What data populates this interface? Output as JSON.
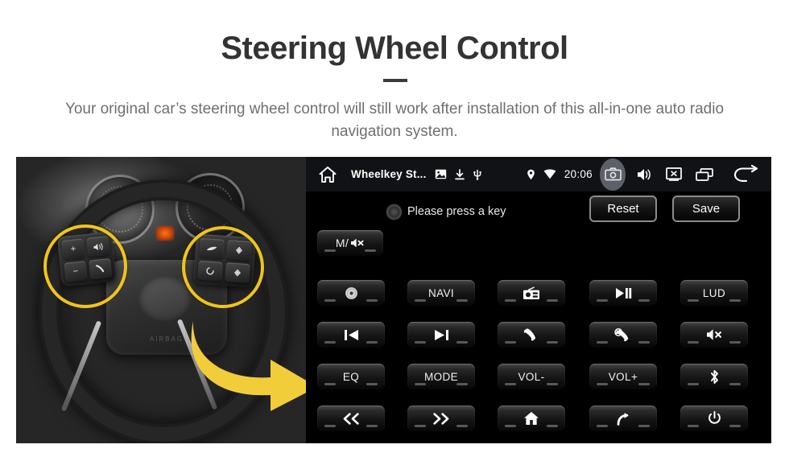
{
  "header": {
    "title": "Steering Wheel Control",
    "subtitle": "Your original car’s steering wheel control will still work after installation of this all-in-one auto radio navigation system."
  },
  "photo": {
    "alt_label": "steering-wheel-photo",
    "airbag_text": "AIRBAG",
    "highlight_color": "#f0c419",
    "arrow_color": "#f2cd3a",
    "left_pad_keys": [
      "+",
      "−",
      "voice-icon",
      "phone-icon"
    ],
    "right_pad_keys": [
      "cruise-icon",
      "up-icon",
      "circle-icon",
      "down-icon"
    ]
  },
  "head_unit": {
    "statusbar": {
      "home_icon": "home-icon",
      "title": "Wheelkey St...",
      "icons": [
        "image-icon",
        "download-icon",
        "usb-icon"
      ],
      "location_icon": "location-pin-icon",
      "wifi_icon": "wifi-icon",
      "clock": "20:06",
      "buttons": [
        {
          "name": "screenshot-icon",
          "active": true
        },
        {
          "name": "volume-icon",
          "active": false
        },
        {
          "name": "close-screen-icon",
          "active": false
        },
        {
          "name": "recent-apps-icon",
          "active": false
        }
      ],
      "back_icon": "back-arrow-icon"
    },
    "prompt": {
      "indicator": "status-indicator",
      "text": "Please press a key"
    },
    "actions": [
      {
        "label": "Reset",
        "name": "reset-button"
      },
      {
        "label": "Save",
        "name": "save-button"
      }
    ],
    "mute_key": {
      "label": "M/",
      "icon": "mute-icon",
      "name": "key-mute-master"
    },
    "keys": [
      [
        {
          "label": "",
          "icon": "disc-icon",
          "name": "key-disc"
        },
        {
          "label": "NAVI",
          "icon": "",
          "name": "key-navi"
        },
        {
          "label": "",
          "icon": "radio-icon",
          "name": "key-radio"
        },
        {
          "label": "",
          "icon": "play-pause-icon",
          "name": "key-play-pause"
        },
        {
          "label": "LUD",
          "icon": "",
          "name": "key-lud"
        }
      ],
      [
        {
          "label": "",
          "icon": "previous-track-icon",
          "name": "key-previous"
        },
        {
          "label": "",
          "icon": "next-track-icon",
          "name": "key-next"
        },
        {
          "label": "",
          "icon": "phone-answer-icon",
          "name": "key-answer-call"
        },
        {
          "label": "",
          "icon": "phone-hangup-icon",
          "name": "key-hangup-call"
        },
        {
          "label": "",
          "icon": "mute-icon",
          "name": "key-mute"
        }
      ],
      [
        {
          "label": "EQ",
          "icon": "",
          "name": "key-eq"
        },
        {
          "label": "MODE",
          "icon": "",
          "name": "key-mode"
        },
        {
          "label": "VOL-",
          "icon": "",
          "name": "key-volume-down"
        },
        {
          "label": "VOL+",
          "icon": "",
          "name": "key-volume-up"
        },
        {
          "label": "",
          "icon": "bluetooth-icon",
          "name": "key-bluetooth"
        }
      ],
      [
        {
          "label": "",
          "icon": "rewind-icon",
          "name": "key-rewind"
        },
        {
          "label": "",
          "icon": "fast-forward-icon",
          "name": "key-fast-forward"
        },
        {
          "label": "",
          "icon": "home-icon",
          "name": "key-home"
        },
        {
          "label": "",
          "icon": "return-icon",
          "name": "key-return"
        },
        {
          "label": "",
          "icon": "power-icon",
          "name": "key-power"
        }
      ]
    ]
  }
}
